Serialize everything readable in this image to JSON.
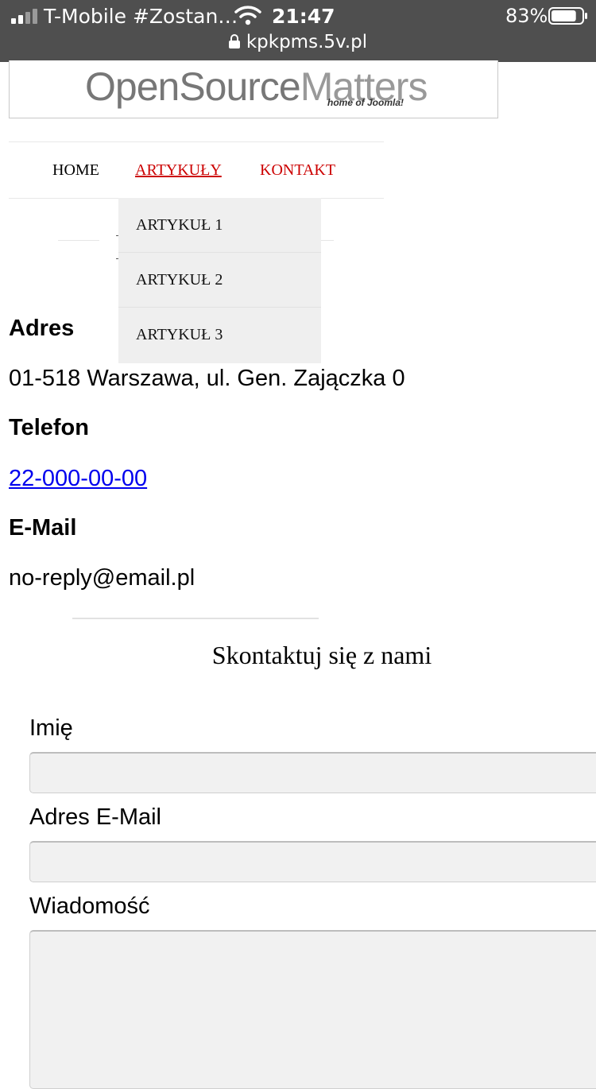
{
  "status_bar": {
    "carrier": "T-Mobile #Zostan…",
    "time": "21:47",
    "battery_percent": "83%",
    "battery_level": 0.83,
    "url": "kpkpms.5v.pl",
    "icons": [
      "signal-icon",
      "wifi-icon",
      "battery-icon",
      "lock-icon"
    ]
  },
  "logo": {
    "text_main": "OpenSource",
    "text_accent": "Matters",
    "tagline": "home of Joomla!"
  },
  "nav": {
    "items": [
      {
        "label": "HOME"
      },
      {
        "label": "ARTYKUŁY"
      },
      {
        "label": "KONTAKT"
      }
    ]
  },
  "dropdown": {
    "items": [
      {
        "label": "ARTYKUŁ 1"
      },
      {
        "label": "ARTYKUŁ 2"
      },
      {
        "label": "ARTYKUŁ 3"
      }
    ]
  },
  "contact": {
    "address_heading": "Adres",
    "address": "01-518 Warszawa, ul. Gen. Zajączka 0",
    "phone_heading": "Telefon",
    "phone": "22-000-00-00",
    "email_heading": "E-Mail",
    "email": "no-reply@email.pl"
  },
  "form": {
    "title": "Skontaktuj się z nami",
    "name_label": "Imię",
    "name_value": "",
    "email_label": "Adres E-Mail",
    "email_value": "",
    "message_label": "Wiadomość",
    "message_value": ""
  },
  "colors": {
    "status_bar_bg": "#4f4f4f",
    "nav_accent": "#cc0000",
    "link": "#0000ee",
    "dropdown_bg": "#efefef",
    "field_bg": "#f1f1f1"
  }
}
